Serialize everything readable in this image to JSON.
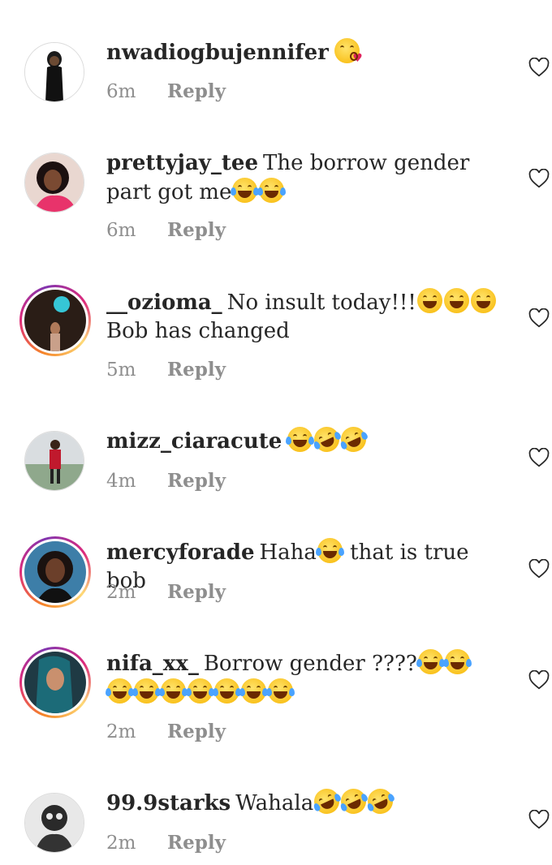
{
  "comments": [
    {
      "username": "nwadiogbujennifer",
      "text": "",
      "emojis": [
        "kiss"
      ],
      "time": "6m",
      "reply": "Reply"
    },
    {
      "username": "prettyjay_tee",
      "text": "The borrow gender part got me",
      "emojis": [
        "joy",
        "joy"
      ],
      "time": "6m",
      "reply": "Reply"
    },
    {
      "username": "__ozioma_",
      "text": "No insult today!!!",
      "emojis": [
        "grin",
        "grin",
        "grin"
      ],
      "text2": "Bob has changed",
      "time": "5m",
      "reply": "Reply"
    },
    {
      "username": "mizz_ciaracute",
      "text": "",
      "emojis": [
        "joy",
        "rofl",
        "rofl"
      ],
      "time": "4m",
      "reply": "Reply"
    },
    {
      "username": "mercyforade",
      "text": "Haha",
      "emojis": [
        "joy"
      ],
      "text2": "that is true bob",
      "time": "2m",
      "reply": "Reply"
    },
    {
      "username": "nifa_xx_",
      "text": "Borrow gender ????",
      "emojis": [
        "joy",
        "joy",
        "joy",
        "joy",
        "joy",
        "joy",
        "joy",
        "joy",
        "joy"
      ],
      "time": "2m",
      "reply": "Reply"
    },
    {
      "username": "99.9starks",
      "text": "Wahala",
      "emojis": [
        "rofl",
        "rofl",
        "rofl"
      ],
      "time": "2m",
      "reply": "Reply"
    }
  ],
  "icons": {
    "like": "heart-outline-icon"
  },
  "colors": {
    "text": "#262626",
    "meta": "#8e8e8e",
    "story_ring_start": "#f58529",
    "story_ring_end": "#8134af"
  }
}
